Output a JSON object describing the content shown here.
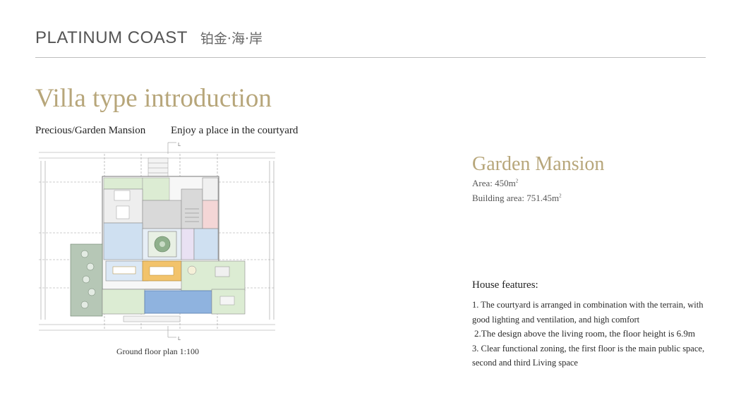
{
  "header": {
    "brand_en": "PLATINUM COAST",
    "brand_cn": "铂金·海·岸"
  },
  "title": "Villa type introduction",
  "subtitle_left": "Precious/Garden Mansion",
  "subtitle_right": "Enjoy a place in the courtyard",
  "plan": {
    "caption": "Ground floor plan 1:100",
    "markers": [
      "L",
      "L"
    ]
  },
  "mansion": {
    "title": "Garden Mansion",
    "area_label": "Area: 450m",
    "area_sup": "2",
    "building_area_label": "Building area: 751.45m",
    "building_area_sup": "2"
  },
  "features": {
    "title": "House features:",
    "items": [
      "1. The courtyard is arranged in combination with the terrain, with good lighting and ventilation, and high comfort",
      "2.The design above the living room, the floor height is 6.9m",
      "3. Clear functional zoning, the first floor is the main public space, second and third Living space"
    ]
  },
  "colors": {
    "accent": "#b7a67a",
    "rule": "#bdbdbd",
    "pool": "#8fb3df",
    "garden": "#dcecd3",
    "dining": "#f2c36b",
    "interior": "#cfe0f1",
    "gray_zone": "#d9d9d9"
  }
}
